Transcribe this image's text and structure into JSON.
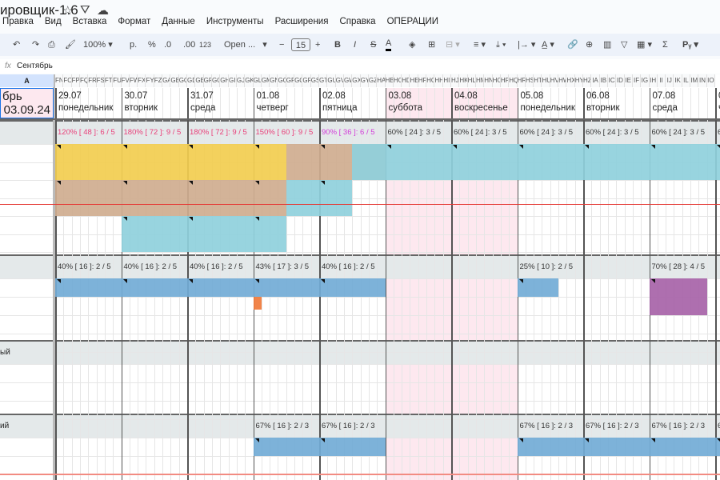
{
  "doc": {
    "title": "ировщик-1.6",
    "icons": [
      "star-icon",
      "move-to-drive-icon",
      "cloud-status-icon"
    ]
  },
  "menu": [
    "Правка",
    "Вид",
    "Вставка",
    "Формат",
    "Данные",
    "Инструменты",
    "Расширения",
    "Справка",
    "ОПЕРАЦИИ"
  ],
  "toolbar": {
    "zoom": "100%",
    "currency": "р.",
    "percent": "%",
    "dec_less": ".0",
    "dec_more": ".00",
    "format_123": "123",
    "font": "Open ...",
    "font_size": "15",
    "bold": "B",
    "italic": "I",
    "sum": "Σ",
    "input_tools": "Рᵧ"
  },
  "formula": {
    "fx": "fx",
    "value": "Сентябрь"
  },
  "column_a": {
    "header": "A",
    "month": "брь",
    "date": "03.09.24"
  },
  "colors": {
    "yellow": "#f2cd4f",
    "brown": "#cfac8f",
    "teal": "#8fd0dc",
    "blue": "#72abd6",
    "purple": "#a763a8",
    "orange": "#f07a3a",
    "weekend": "#fde8ef",
    "header_gray": "#e4e9ea",
    "pct_red": "#e8407a",
    "pct_magenta": "#d23cd8"
  },
  "days": [
    {
      "date": "29.07",
      "weekday": "понедельник"
    },
    {
      "date": "30.07",
      "weekday": "вторник"
    },
    {
      "date": "31.07",
      "weekday": "среда"
    },
    {
      "date": "01.08",
      "weekday": "четверг"
    },
    {
      "date": "02.08",
      "weekday": "пятница"
    },
    {
      "date": "03.08",
      "weekday": "суббота",
      "weekend": true
    },
    {
      "date": "04.08",
      "weekday": "воскресенье",
      "weekend": true
    },
    {
      "date": "05.08",
      "weekday": "понедельник"
    },
    {
      "date": "06.08",
      "weekday": "вторник"
    },
    {
      "date": "07.08",
      "weekday": "среда"
    },
    {
      "date": "0",
      "weekday": "ч"
    }
  ],
  "sections": [
    {
      "label": "",
      "stats": [
        {
          "t": "120% [ 48 ]: 6 / 5",
          "c": "pct_red"
        },
        {
          "t": "180% [ 72 ]: 9 / 5",
          "c": "pct_red"
        },
        {
          "t": "180% [ 72 ]: 9 / 5",
          "c": "pct_red"
        },
        {
          "t": "150% [ 60 ]: 9 / 5",
          "c": "pct_red"
        },
        {
          "t": "90% [ 36 ]: 6 / 5",
          "c": "pct_magenta"
        },
        {
          "t": "60% [ 24 ]: 3 / 5"
        },
        {
          "t": "60% [ 24 ]: 3 / 5"
        },
        {
          "t": "60% [ 24 ]: 3 / 5"
        },
        {
          "t": "60% [ 24 ]: 3 / 5"
        },
        {
          "t": "60% [ 24 ]: 3 / 5"
        },
        {
          "t": "6"
        }
      ]
    },
    {
      "label": "",
      "stats": [
        {
          "t": "40% [ 16 ]: 2 / 5"
        },
        {
          "t": "40% [ 16 ]: 2 / 5"
        },
        {
          "t": "40% [ 16 ]: 2 / 5"
        },
        {
          "t": "43% [ 17 ]: 3 / 5"
        },
        {
          "t": "40% [ 16 ]: 2 / 5"
        },
        {
          "t": ""
        },
        {
          "t": ""
        },
        {
          "t": "25% [ 10 ]: 2 / 5"
        },
        {
          "t": ""
        },
        {
          "t": "70% [ 28 ]: 4 / 5"
        }
      ]
    },
    {
      "label": "ый",
      "stats": []
    },
    {
      "label": "ий",
      "stats": [
        null,
        null,
        null,
        {
          "t": "67% [ 16 ]: 2 / 3"
        },
        {
          "t": "67% [ 16 ]: 2 / 3"
        },
        null,
        null,
        {
          "t": "67% [ 16 ]: 2 / 3"
        },
        {
          "t": "67% [ 16 ]: 2 / 3"
        },
        {
          "t": "67% [ 16 ]: 2 / 3"
        },
        {
          "t": "6"
        }
      ]
    }
  ],
  "bars": [
    {
      "s": 0,
      "day": 0,
      "days": 3.5,
      "row": 0,
      "rows": 2,
      "c": "yellow"
    },
    {
      "s": 0,
      "day": 3.5,
      "days": 1.5,
      "row": 0,
      "rows": 2,
      "c": "brown"
    },
    {
      "s": 0,
      "day": 4.5,
      "days": 6.5,
      "row": 0,
      "rows": 2,
      "c": "teal"
    },
    {
      "s": 0,
      "day": 0,
      "days": 3.5,
      "row": 2,
      "rows": 2,
      "c": "brown"
    },
    {
      "s": 0,
      "day": 3.5,
      "days": 1,
      "row": 2,
      "rows": 2,
      "c": "teal"
    },
    {
      "s": 0,
      "day": 1,
      "days": 2.5,
      "row": 4,
      "rows": 2,
      "c": "teal"
    },
    {
      "s": 1,
      "day": 0,
      "days": 5,
      "row": 0,
      "rows": 1,
      "c": "blue"
    },
    {
      "s": 1,
      "day": 3,
      "days": 0.125,
      "row": 1,
      "rows": 0.7,
      "c": "orange"
    },
    {
      "s": 1,
      "day": 7,
      "days": 0.625,
      "row": 0,
      "rows": 1,
      "c": "blue"
    },
    {
      "s": 1,
      "day": 9,
      "days": 0.875,
      "row": 0,
      "rows": 2,
      "c": "purple"
    },
    {
      "s": 3,
      "day": 3,
      "days": 2,
      "row": 0,
      "rows": 1,
      "c": "blue"
    },
    {
      "s": 3,
      "day": 7,
      "days": 4,
      "row": 0,
      "rows": 1,
      "c": "blue"
    }
  ]
}
